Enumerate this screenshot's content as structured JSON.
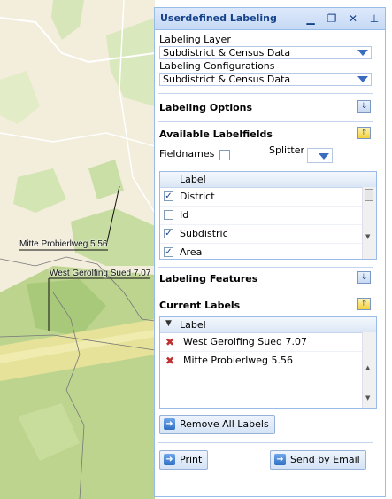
{
  "map": {
    "labels": [
      "Mitte Probierlweg 5.56",
      "West Gerolfing Sued 7.07"
    ]
  },
  "panel": {
    "title": "Userdefined Labeling",
    "labeling_layer_label": "Labeling Layer",
    "labeling_layer_value": "Subdistrict & Census Data",
    "labeling_config_label": "Labeling Configurations",
    "labeling_config_value": "Subdistrict & Census Data",
    "labeling_options": "Labeling Options",
    "available_labelfields": "Available Labelfields",
    "fieldnames": "Fieldnames",
    "splitter": "Splitter",
    "labelfields_header": "Label",
    "labelfields": [
      {
        "label": "District",
        "checked": true
      },
      {
        "label": "Id",
        "checked": false
      },
      {
        "label": "Subdistric",
        "checked": true
      },
      {
        "label": "Area",
        "checked": true
      }
    ],
    "labeling_features": "Labeling Features",
    "current_labels": "Current Labels",
    "current_header": "Label",
    "current_list": [
      "West Gerolfing Sued 7.07",
      "Mitte Probierlweg 5.56"
    ],
    "remove_all": "Remove All Labels",
    "print": "Print",
    "send_email": "Send by Email"
  },
  "colors": {
    "accent": "#15428b",
    "border": "#99bbe8",
    "delete": "#c03030"
  }
}
